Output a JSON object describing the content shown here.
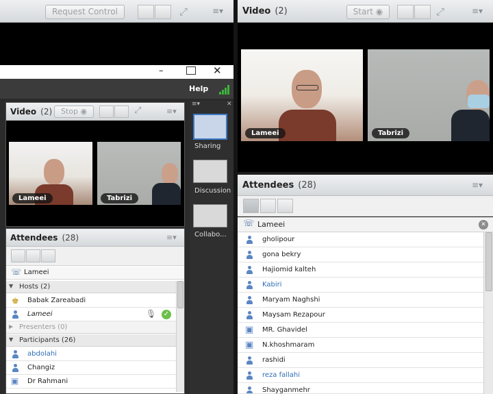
{
  "left_top": {
    "request_control": "Request Control"
  },
  "browser": {
    "help": "Help"
  },
  "left_video": {
    "title": "Video",
    "count": "(2)",
    "stop": "Stop",
    "tiles": [
      "Lameei",
      "Tabrizi"
    ]
  },
  "layouts": [
    "Sharing",
    "Discussion",
    "Collabo..."
  ],
  "left_att": {
    "title": "Attendees",
    "count": "(28)",
    "speaker": "Lameei",
    "hosts_header": "Hosts (2)",
    "hosts": [
      "Babak Zareabadi",
      "Lameei"
    ],
    "presenters_header": "Presenters (0)",
    "participants_header": "Participants (26)",
    "participants": [
      "abdolahi",
      "Changiz",
      "Dr Rahmani"
    ]
  },
  "right_video": {
    "title": "Video",
    "count": "(2)",
    "start": "Start",
    "tiles": [
      "Lameei",
      "Tabrizi"
    ]
  },
  "right_att": {
    "title": "Attendees",
    "count": "(28)",
    "speaker": "Lameei",
    "list": [
      "gholipour",
      "gona bekry",
      "Hajiomid kalteh",
      "Kabiri",
      "Maryam Naghshi",
      "Maysam Rezapour",
      "MR. Ghavidel",
      "N.khoshmaram",
      "rashidi",
      "reza fallahi",
      "Shayganmehr"
    ]
  },
  "colors": {
    "link_blue": "#2f6db5",
    "signal_green": "#3cb33c"
  }
}
